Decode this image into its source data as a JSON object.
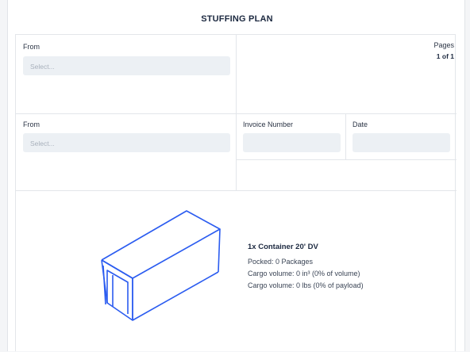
{
  "page": {
    "title": "STUFFING PLAN"
  },
  "section_top": {
    "from_label": "From",
    "from_placeholder": "Select...",
    "pages_label": "Pages",
    "pages_value": "1 of 1"
  },
  "section_middle": {
    "from_label": "From",
    "from_placeholder": "Select...",
    "invoice_label": "Invoice Number",
    "invoice_value": "",
    "date_label": "Date",
    "date_value": ""
  },
  "container": {
    "heading": "1x Container 20' DV",
    "packed": "Pocked: 0 Packages",
    "cargo_volume": "Cargo volume: 0 in³ (0% of volume)",
    "cargo_weight": "Cargo volume: 0 lbs (0% of payload)",
    "icon": "container-wireframe-icon",
    "stroke_color": "#2b5cf0"
  },
  "colors": {
    "field_bg": "#ecf0f4",
    "border": "#e3e6ea",
    "text": "#1c2940"
  }
}
